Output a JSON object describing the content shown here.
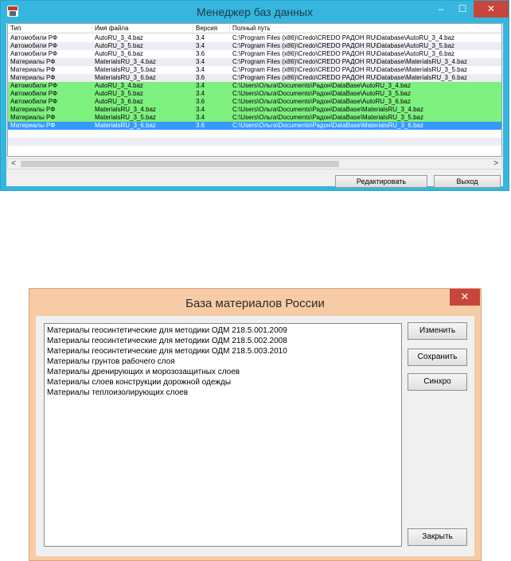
{
  "db_manager": {
    "title": "Менеджер баз данных",
    "controls": {
      "minimize": "–",
      "maximize": "☐",
      "close": "✕"
    },
    "columns": [
      "Тип",
      "Имя файла",
      "Версия",
      "Полный путь"
    ],
    "rows": [
      {
        "type": "Автомобили РФ",
        "file": "AutoRU_3_4.baz",
        "version": "3.4",
        "path": "C:\\Program Files (x86)\\Credo\\CREDO РАДОН RU\\Database\\AutoRU_3_4.baz"
      },
      {
        "type": "Автомобили РФ",
        "file": "AutoRU_3_5.baz",
        "version": "3.4",
        "path": "C:\\Program Files (x86)\\Credo\\CREDO РАДОН RU\\Database\\AutoRU_3_5.baz"
      },
      {
        "type": "Автомобили РФ",
        "file": "AutoRU_3_6.baz",
        "version": "3.6",
        "path": "C:\\Program Files (x86)\\Credo\\CREDO РАДОН RU\\Database\\AutoRU_3_6.baz"
      },
      {
        "type": "Материалы РФ",
        "file": "MaterialsRU_3_4.baz",
        "version": "3.4",
        "path": "C:\\Program Files (x86)\\Credo\\CREDO РАДОН RU\\Database\\MaterialsRU_3_4.baz"
      },
      {
        "type": "Материалы РФ",
        "file": "MaterialsRU_3_5.baz",
        "version": "3.4",
        "path": "C:\\Program Files (x86)\\Credo\\CREDO РАДОН RU\\Database\\MaterialsRU_3_5.baz"
      },
      {
        "type": "Материалы РФ",
        "file": "MaterialsRU_3_6.baz",
        "version": "3.6",
        "path": "C:\\Program Files (x86)\\Credo\\CREDO РАДОН RU\\Database\\MaterialsRU_3_6.baz"
      },
      {
        "type": "Автомобили РФ",
        "file": "AutoRU_3_4.baz",
        "version": "3.4",
        "path": "C:\\Users\\Ольга\\Documents\\Радон\\DataBase\\AutoRU_3_4.baz"
      },
      {
        "type": "Автомобили РФ",
        "file": "AutoRU_3_5.baz",
        "version": "3.4",
        "path": "C:\\Users\\Ольга\\Documents\\Радон\\DataBase\\AutoRU_3_5.baz"
      },
      {
        "type": "Автомобили РФ",
        "file": "AutoRU_3_6.baz",
        "version": "3.6",
        "path": "C:\\Users\\Ольга\\Documents\\Радон\\DataBase\\AutoRU_3_6.baz"
      },
      {
        "type": "Материалы РФ",
        "file": "MaterialsRU_3_4.baz",
        "version": "3.4",
        "path": "C:\\Users\\Ольга\\Documents\\Радон\\DataBase\\MaterialsRU_3_4.baz"
      },
      {
        "type": "Материалы РФ",
        "file": "MaterialsRU_3_5.baz",
        "version": "3.4",
        "path": "C:\\Users\\Ольга\\Documents\\Радон\\DataBase\\MaterialsRU_3_5.baz"
      },
      {
        "type": "Материалы РФ",
        "file": "MaterialsRU_3_6.baz",
        "version": "3.6",
        "path": "C:\\Users\\Ольга\\Documents\\Радон\\DataBase\\MaterialsRU_3_6.baz"
      }
    ],
    "row_styles": [
      "plain",
      "alt",
      "plain",
      "alt",
      "plain",
      "alt",
      "green",
      "green",
      "green",
      "green",
      "green",
      "selected"
    ],
    "scroll_arrows": {
      "left": "<",
      "right": ">"
    },
    "buttons": {
      "edit": "Редактировать",
      "exit": "Выход"
    },
    "colors": {
      "titlebar": "#36b6de",
      "green_row": "#7ef07e",
      "selected_row": "#3399ff",
      "close": "#c7453a"
    }
  },
  "materials_dialog": {
    "title": "База материалов России",
    "close": "✕",
    "items": [
      "Материалы геосинтетические для методики ОДМ 218.5.001.2009",
      "Материалы геосинтетические для методики ОДМ 218.5.002.2008",
      "Материалы геосинтетические для методики ОДМ 218.5.003.2010",
      "Материалы грунтов рабочего слоя",
      "Материалы дренирующих и морозозащитных слоев",
      "Материалы слоев конструкции дорожной одежды",
      "Материалы теплоизолирующих слоев"
    ],
    "buttons": {
      "edit": "Изменить",
      "save": "Сохранить",
      "sync": "Синхро",
      "close": "Закрыть"
    },
    "colors": {
      "frame": "#f7cba5"
    }
  }
}
